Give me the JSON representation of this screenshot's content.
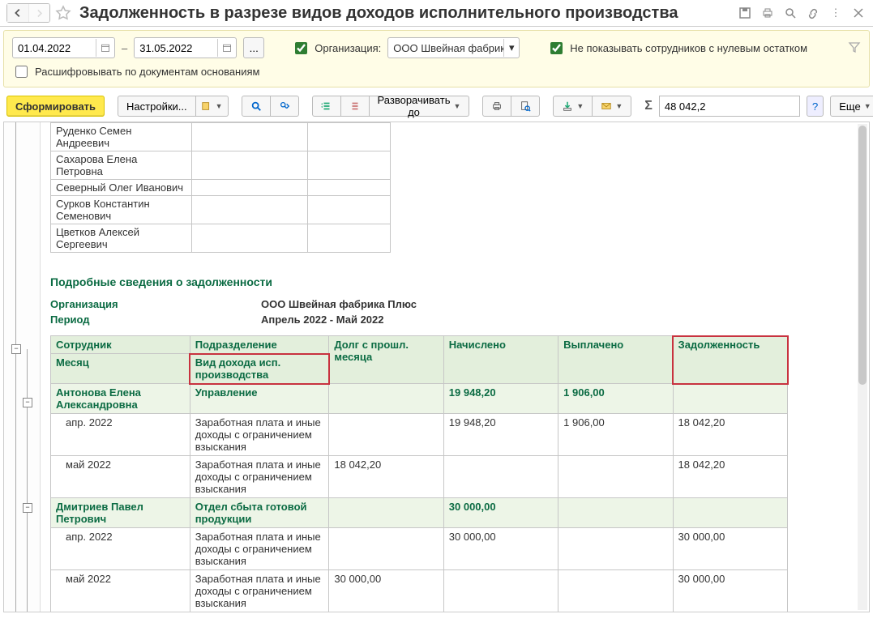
{
  "title": "Задолженность в разрезе видов доходов исполнительного производства",
  "filters": {
    "date_from": "01.04.2022",
    "date_to": "31.05.2022",
    "org_label": "Организация:",
    "org_value": "ООО Швейная фабрик",
    "hide_zero_label": "Не показывать сотрудников с нулевым остатком",
    "hide_zero_checked": true,
    "org_checked": true,
    "decode_label": "Расшифровывать по документам основаниям",
    "decode_checked": false
  },
  "toolbar": {
    "generate": "Сформировать",
    "settings": "Настройки...",
    "expand_to": "Разворачивать до",
    "sum_value": "48 042,2",
    "more": "Еще"
  },
  "top_employees": [
    "Руденко Семен Андреевич",
    "Сахарова Елена Петровна",
    "Северный Олег Иванович",
    "Сурков Константин Семенович",
    "Цветков Алексей Сергеевич"
  ],
  "report": {
    "section_title": "Подробные сведения о задолженности",
    "org_label": "Организация",
    "org_value": "ООО Швейная фабрика Плюс",
    "period_label": "Период",
    "period_value": "Апрель 2022 - Май 2022",
    "header": {
      "employee": "Сотрудник",
      "month": "Месяц",
      "dept": "Подразделение",
      "income_type": "Вид дохода исп. производства",
      "prev_debt": "Долг с прошл. месяца",
      "accrued": "Начислено",
      "paid": "Выплачено",
      "debt": "Задолженность"
    },
    "groups": [
      {
        "employee": "Антонова Елена Александровна",
        "dept": "Управление",
        "accrued": "19 948,20",
        "paid": "1 906,00",
        "debt": "",
        "rows": [
          {
            "month": "апр. 2022",
            "income": "Заработная плата и иные доходы с ограничением взыскания",
            "prev": "",
            "accrued": "19 948,20",
            "paid": "1 906,00",
            "debt": "18 042,20"
          },
          {
            "month": "май 2022",
            "income": "Заработная плата и иные доходы с ограничением взыскания",
            "prev": "18 042,20",
            "accrued": "",
            "paid": "",
            "debt": "18 042,20"
          }
        ]
      },
      {
        "employee": "Дмитриев Павел Петрович",
        "dept": "Отдел сбыта готовой продукции",
        "accrued": "30 000,00",
        "paid": "",
        "debt": "",
        "rows": [
          {
            "month": "апр. 2022",
            "income": "Заработная плата и иные доходы с ограничением взыскания",
            "prev": "",
            "accrued": "30 000,00",
            "paid": "",
            "debt": "30 000,00"
          },
          {
            "month": "май 2022",
            "income": "Заработная плата и иные доходы с ограничением взыскания",
            "prev": "30 000,00",
            "accrued": "",
            "paid": "",
            "debt": "30 000,00"
          }
        ]
      }
    ]
  }
}
